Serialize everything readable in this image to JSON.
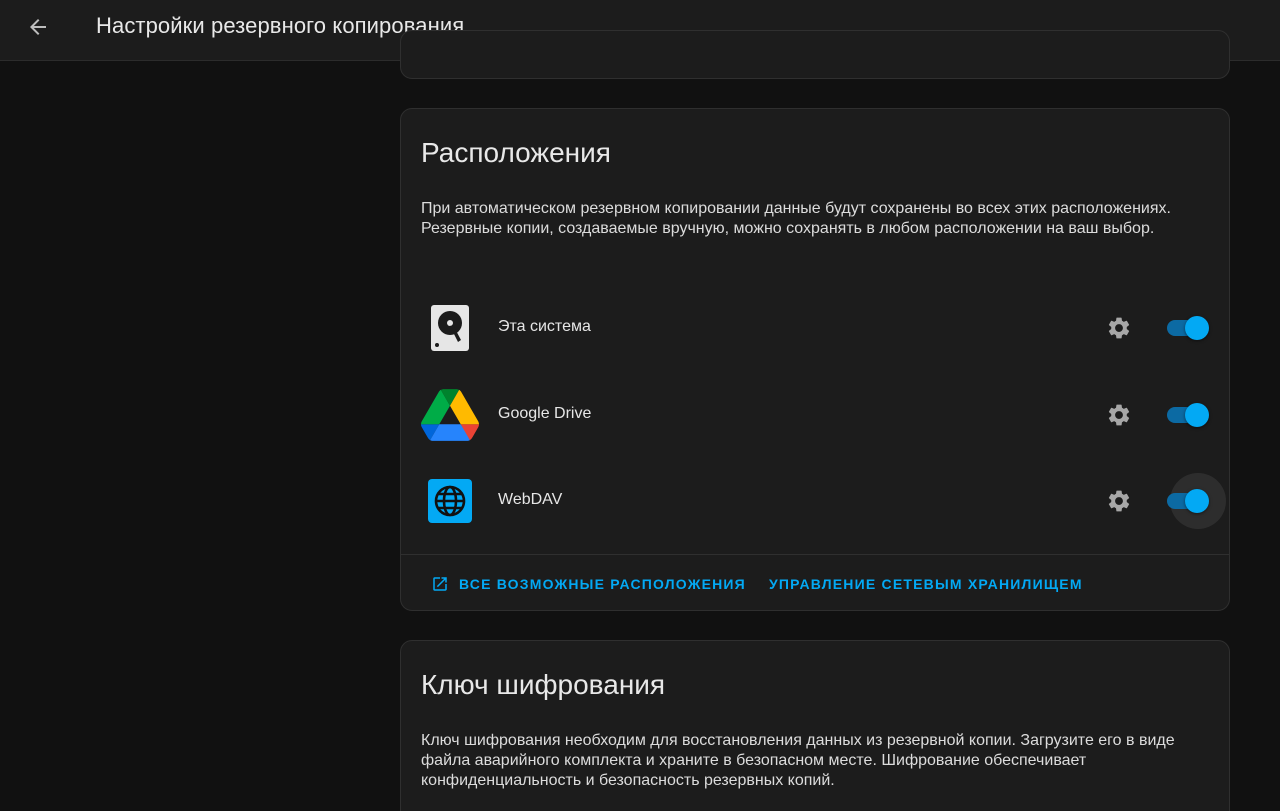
{
  "header": {
    "title": "Настройки резервного копирования"
  },
  "locations": {
    "title": "Расположения",
    "description": "При автоматическом резервном копировании данные будут сохранены во всех этих расположениях. Резервные копии, создаваемые вручную, можно сохранять в любом расположении на ваш выбор.",
    "items": [
      {
        "name": "Эта система",
        "icon": "harddisk-icon",
        "enabled": true
      },
      {
        "name": "Google Drive",
        "icon": "google-drive-icon",
        "enabled": true
      },
      {
        "name": "WebDAV",
        "icon": "globe-icon",
        "enabled": true
      }
    ],
    "actions": {
      "all_locations": "ВСЕ ВОЗМОЖНЫЕ РАСПОЛОЖЕНИЯ",
      "manage_network": "УПРАВЛЕНИЕ СЕТЕВЫМ ХРАНИЛИЩЕМ"
    }
  },
  "encryption": {
    "title": "Ключ шифрования",
    "description": "Ключ шифрования необходим для восстановления данных из резервной копии. Загрузите его в виде файла аварийного комплекта и храните в безопасном месте. Шифрование обеспечивает конфиденциальность и безопасность резервных копий."
  },
  "colors": {
    "accent": "#03a9f4",
    "background": "#111111",
    "card": "#1c1c1c"
  }
}
